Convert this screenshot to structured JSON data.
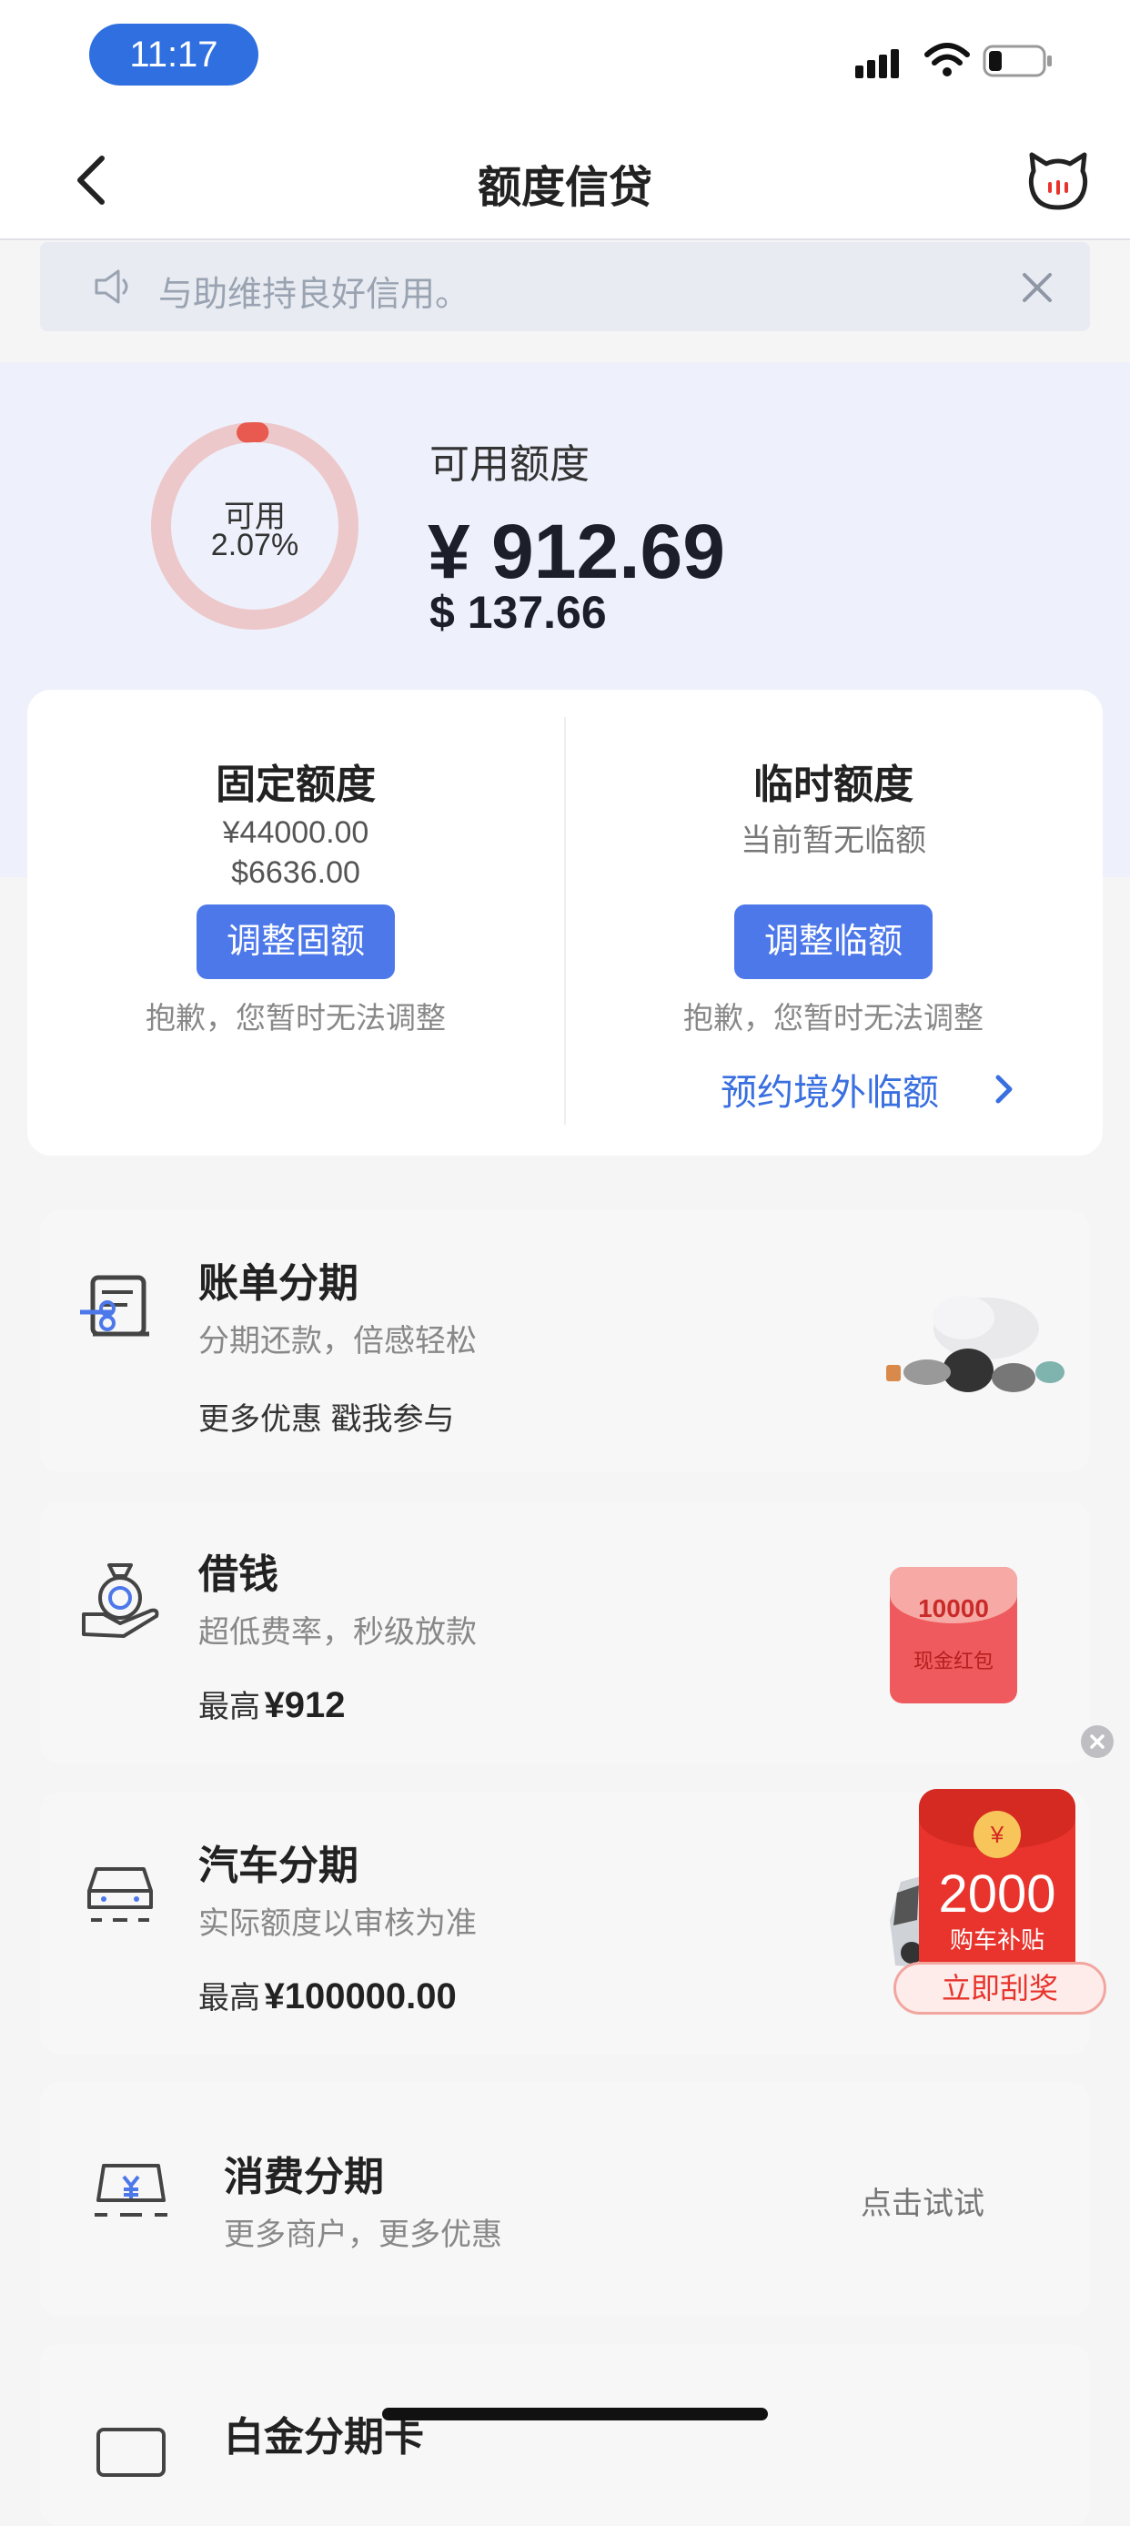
{
  "status_bar": {
    "time": "11:17"
  },
  "nav": {
    "title": "额度信贷"
  },
  "notice": {
    "text": "与助维持良好信用。"
  },
  "available": {
    "ring_label": "可用",
    "ring_percent": "2.07%",
    "ring_fraction": 0.0207,
    "title": "可用额度",
    "amount_cny": "¥ 912.69",
    "amount_usd": "$ 137.66"
  },
  "fixed": {
    "title": "固定额度",
    "cny": "¥44000.00",
    "usd": "$6636.00",
    "button": "调整固额",
    "note": "抱歉，您暂时无法调整"
  },
  "temporary": {
    "title": "临时额度",
    "status": "当前暂无临额",
    "button": "调整临额",
    "note": "抱歉，您暂时无法调整",
    "link": "预约境外临额"
  },
  "items": [
    {
      "title": "账单分期",
      "sub": "分期还款，倍感轻松",
      "extra": "更多优惠 戳我参与"
    },
    {
      "title": "借钱",
      "sub": "超低费率，秒级放款",
      "extra_prefix": "最高",
      "extra_value": "¥912",
      "promo_amount": "10000",
      "promo_label": "现金红包"
    },
    {
      "title": "汽车分期",
      "sub": "实际额度以审核为准",
      "extra_prefix": "最高",
      "extra_value": "¥100000.00"
    },
    {
      "title": "消费分期",
      "sub": "更多商户，更多优惠",
      "action": "点击试试"
    },
    {
      "title": "白金分期卡"
    }
  ],
  "floating_promo": {
    "coin": "¥",
    "amount": "2000",
    "label": "购车补贴",
    "button": "立即刮奖"
  },
  "colors": {
    "accent": "#4d78ea",
    "ring": "#e85a4f",
    "promo": "#e8342c"
  }
}
